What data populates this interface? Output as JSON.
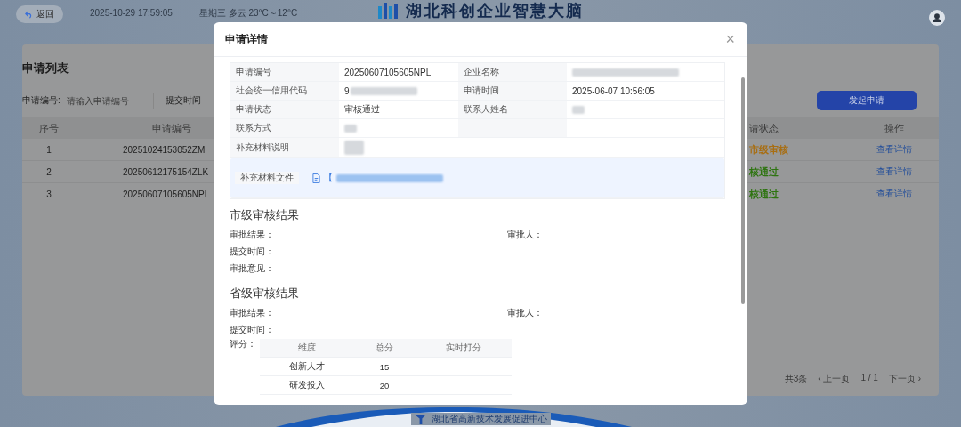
{
  "header": {
    "back_button": "返回",
    "datetime": "2025-10-29  17:59:05",
    "weather": "星期三  多云  23°C～12°C",
    "title": "湖北科创企业智慧大脑"
  },
  "list": {
    "title": "申请列表",
    "filter_label": "申请编号:",
    "filter_placeholder": "请输入申请编号",
    "filter_2_label": "提交时间",
    "create_button": "发起申请",
    "columns": [
      "序号",
      "申请编号",
      "请状态",
      "操作"
    ],
    "rows": [
      {
        "index": "1",
        "number": "20251024153052ZM",
        "status": "市级审核",
        "color": "#a86e12",
        "action": "查看详情"
      },
      {
        "index": "2",
        "number": "20250612175154ZLK",
        "status": "核通过",
        "color": "#2e7410",
        "action": "查看详情"
      },
      {
        "index": "3",
        "number": "20250607105605NPL",
        "status": "核通过",
        "color": "#2e7410",
        "action": "查看详情"
      }
    ],
    "pagination": {
      "total": "共3条",
      "prev": "‹ 上一页",
      "page": "1 / 1",
      "next": "下一页 ›"
    }
  },
  "footer": {
    "org": "湖北省高新技术发展促进中心"
  },
  "modal": {
    "title": "申请详情",
    "close": "×",
    "details": [
      {
        "kind": "pair",
        "cells": [
          {
            "label": "申请编号",
            "value": "20250607105605NPL",
            "redacted": false
          },
          {
            "label": "企业名称",
            "redacted": true
          }
        ]
      },
      {
        "kind": "pair",
        "cells": [
          {
            "label": "社会统一信用代码",
            "value": "9",
            "redacted": true
          },
          {
            "label": "申请时间",
            "value": "2025-06-07 10:56:05",
            "redacted": false
          }
        ]
      },
      {
        "kind": "pair",
        "cells": [
          {
            "label": "申请状态",
            "value": "审核通过",
            "redacted": false
          },
          {
            "label": "联系人姓名",
            "redacted": true
          }
        ]
      },
      {
        "kind": "half",
        "cells": [
          {
            "label": "联系方式",
            "redacted": true
          }
        ]
      },
      {
        "kind": "wide",
        "cells": [
          {
            "label": "补充材料说明",
            "redacted": true
          }
        ]
      },
      {
        "kind": "file",
        "cells": [
          {
            "label": "补充材料文件",
            "value": "【",
            "redacted": true
          }
        ]
      }
    ],
    "city_review": {
      "title": "市级审核结果",
      "result_label": "审批结果：",
      "approver_label": "审批人：",
      "fields": [
        "提交时间：",
        "审批意见："
      ]
    },
    "province_review": {
      "title": "省级审核结果",
      "result_label": "审批结果：",
      "approver_label": "审批人：",
      "fields": [
        "提交时间："
      ],
      "score_label": "评分：",
      "score_columns": [
        "维度",
        "总分",
        "实时打分"
      ],
      "score_rows": [
        [
          "创新人才",
          "15",
          ""
        ],
        [
          "研发投入",
          "20",
          ""
        ]
      ]
    }
  }
}
